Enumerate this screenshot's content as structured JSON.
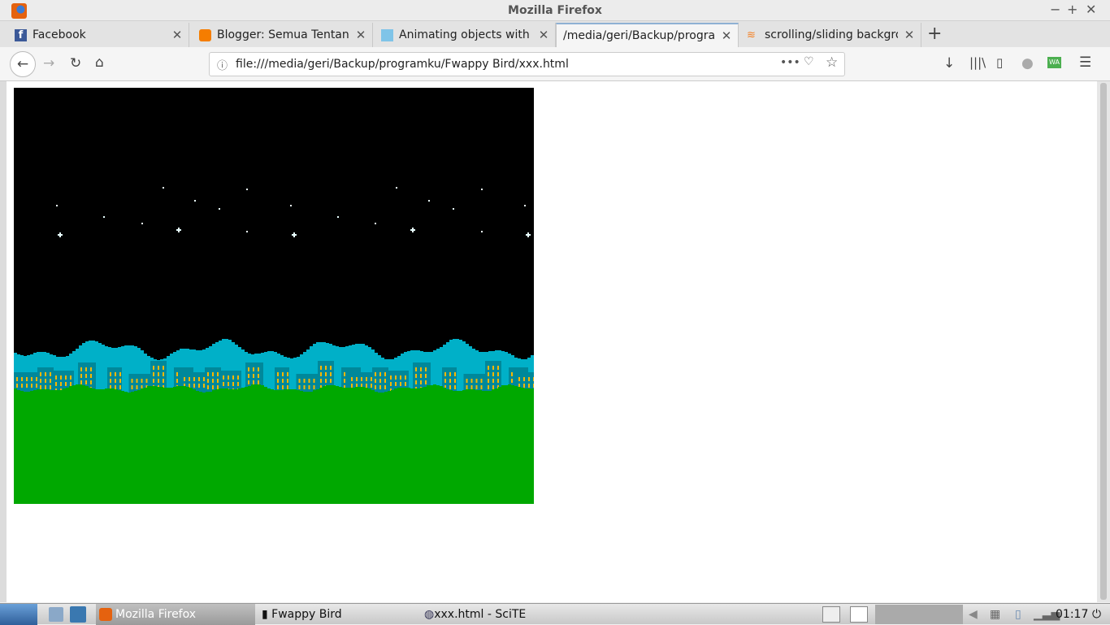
{
  "window": {
    "title": "Mozilla Firefox"
  },
  "tabs": [
    {
      "label": "Facebook",
      "icon": "facebook-icon",
      "active": false
    },
    {
      "label": "Blogger: Semua Tentang",
      "icon": "blogger-icon",
      "active": false
    },
    {
      "label": "Animating objects with W",
      "icon": "page-icon",
      "active": false
    },
    {
      "label": "/media/geri/Backup/progra",
      "icon": "none",
      "active": true
    },
    {
      "label": "scrolling/sliding backgro",
      "icon": "stackoverflow-icon",
      "active": false
    }
  ],
  "url": "file:///media/geri/Backup/programku/Fwappy Bird/xxx.html",
  "scene": {
    "colors": {
      "sky": "#000000",
      "clouds": "#00b0c8",
      "buildings": "#00889a",
      "windows": "#f8b800",
      "ground": "#00a800",
      "stars": "#e8ffff"
    }
  },
  "taskbar": {
    "items": [
      "Mozilla Firefox",
      "Fwappy Bird",
      "xxx.html - SciTE"
    ],
    "clock": "01:17"
  }
}
